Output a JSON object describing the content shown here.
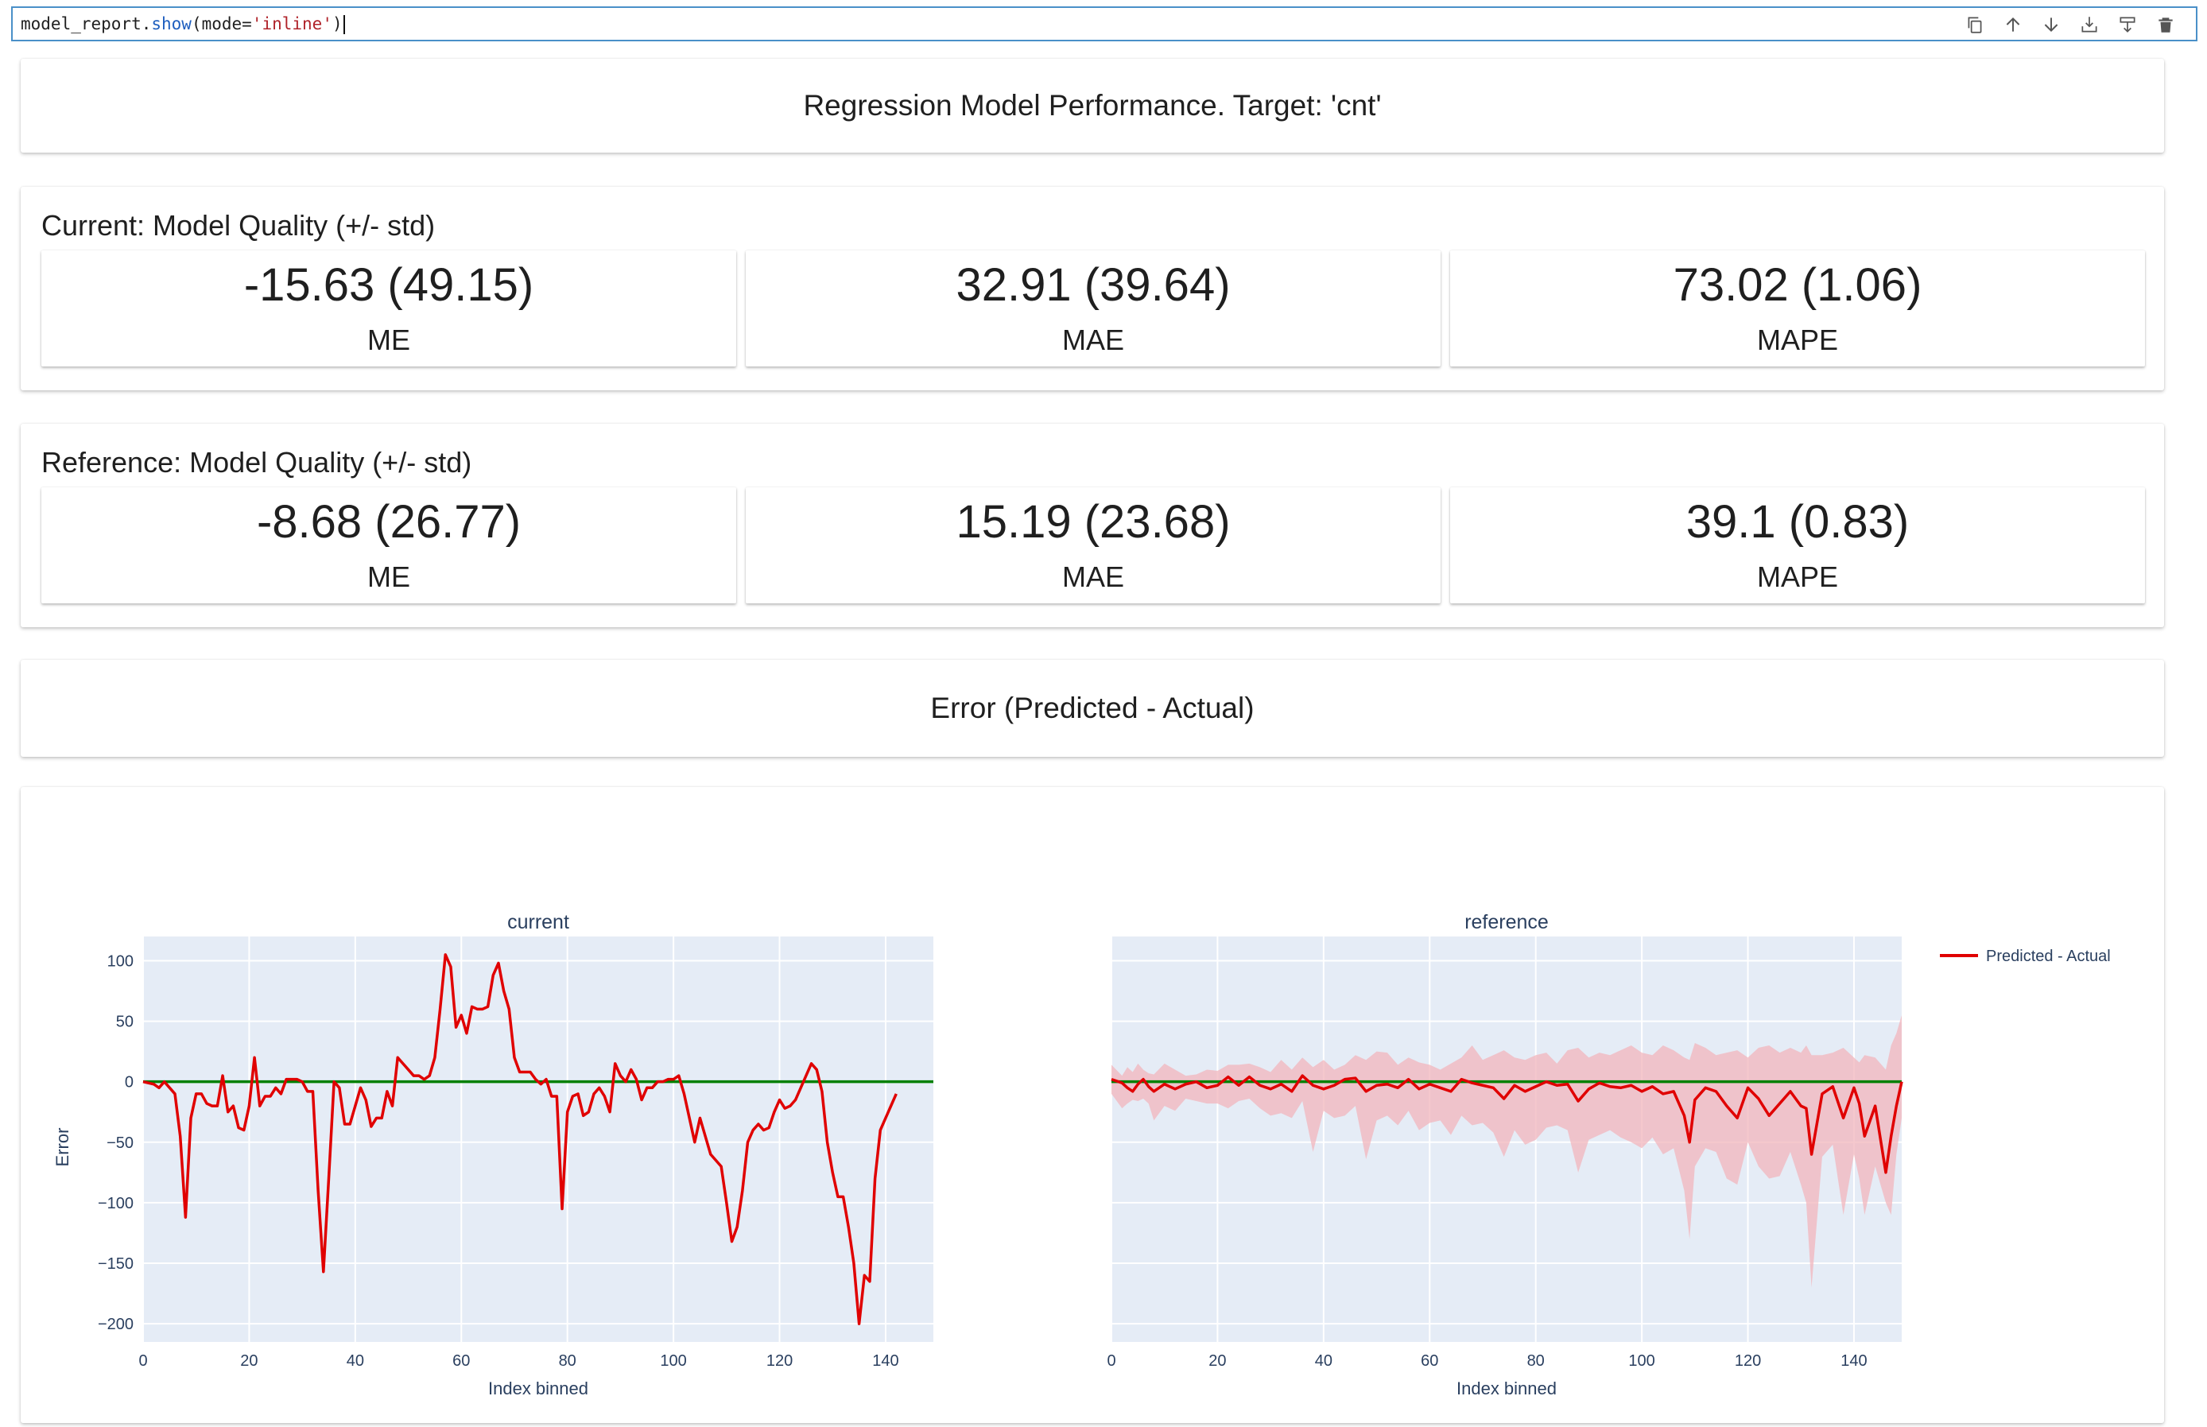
{
  "cell": {
    "code_prefix": "model_report.",
    "code_fn": "show",
    "code_open": "(mode=",
    "code_str": "'inline'",
    "code_close": ")"
  },
  "toolbar": {
    "icons": [
      "duplicate-icon",
      "move-up-icon",
      "move-down-icon",
      "insert-below-icon",
      "merge-icon",
      "delete-icon"
    ]
  },
  "report": {
    "title": "Regression Model Performance. Target: 'cnt'",
    "current": {
      "heading": "Current: Model Quality (+/- std)",
      "metrics": [
        {
          "value": "-15.63 (49.15)",
          "label": "ME"
        },
        {
          "value": "32.91 (39.64)",
          "label": "MAE"
        },
        {
          "value": "73.02 (1.06)",
          "label": "MAPE"
        }
      ]
    },
    "reference": {
      "heading": "Reference: Model Quality (+/- std)",
      "metrics": [
        {
          "value": "-8.68 (26.77)",
          "label": "ME"
        },
        {
          "value": "15.19 (23.68)",
          "label": "MAE"
        },
        {
          "value": "39.1 (0.83)",
          "label": "MAPE"
        }
      ]
    },
    "error_title": "Error (Predicted - Actual)"
  },
  "colors": {
    "plot_bg": "#e5ecf6",
    "line": "#e00000",
    "zero_line": "#008000",
    "band": "#f2b5bc",
    "cell_border": "#4a90c8"
  },
  "chart_data": {
    "type": "line",
    "ylabel": "Error",
    "xlabel": "Index binned",
    "xlim": [
      0,
      149
    ],
    "ylim": [
      -215,
      120
    ],
    "x_ticks": [
      0,
      20,
      40,
      60,
      80,
      100,
      120,
      140
    ],
    "y_ticks": [
      100,
      50,
      0,
      -50,
      -100,
      -150,
      -200
    ],
    "y_tick_labels": [
      "100",
      "50",
      "0",
      "−50",
      "−100",
      "−150",
      "−200"
    ],
    "legend": {
      "label": "Predicted - Actual",
      "position": "top-right"
    },
    "panels": [
      {
        "title": "current",
        "series": [
          {
            "name": "Predicted - Actual",
            "x": [
              0,
              2,
              3,
              4,
              6,
              7,
              8,
              9,
              10,
              11,
              12,
              13,
              14,
              15,
              16,
              17,
              18,
              19,
              20,
              21,
              22,
              23,
              24,
              25,
              26,
              27,
              28,
              29,
              30,
              31,
              32,
              33,
              34,
              35,
              36,
              37,
              38,
              39,
              40,
              41,
              42,
              43,
              44,
              45,
              46,
              47,
              48,
              49,
              50,
              51,
              52,
              53,
              54,
              55,
              56,
              57,
              58,
              59,
              60,
              61,
              62,
              63,
              64,
              65,
              66,
              67,
              68,
              69,
              70,
              71,
              72,
              73,
              74,
              75,
              76,
              77,
              78,
              79,
              80,
              81,
              82,
              83,
              84,
              85,
              86,
              87,
              88,
              89,
              90,
              91,
              92,
              93,
              94,
              95,
              96,
              97,
              98,
              99,
              100,
              101,
              102,
              103,
              104,
              105,
              106,
              107,
              108,
              109,
              110,
              111,
              112,
              113,
              114,
              115,
              116,
              117,
              118,
              119,
              120,
              121,
              122,
              123,
              124,
              125,
              126,
              127,
              128,
              129,
              130,
              131,
              132,
              133,
              134,
              135,
              136,
              137,
              138,
              139,
              140,
              141,
              142,
              143,
              144,
              145,
              146,
              147,
              148,
              149
            ],
            "y": [
              0,
              -2,
              -5,
              0,
              -10,
              -45,
              -112,
              -30,
              -10,
              -10,
              -18,
              -20,
              -20,
              5,
              -25,
              -20,
              -38,
              -40,
              -20,
              20,
              -20,
              -12,
              -12,
              -5,
              -10,
              2,
              2,
              2,
              0,
              -8,
              -8,
              -90,
              -157,
              -80,
              0,
              -5,
              -35,
              -35,
              -20,
              -5,
              -15,
              -37,
              -30,
              -30,
              -8,
              -20,
              20,
              15,
              10,
              5,
              5,
              2,
              5,
              20,
              60,
              105,
              95,
              45,
              55,
              40,
              62,
              60,
              60,
              62,
              88,
              98,
              75,
              60,
              20,
              8,
              8,
              8,
              2,
              -2,
              2,
              -12,
              -12,
              -105,
              -25,
              -12,
              -10,
              -28,
              -25,
              -10,
              -5,
              -12,
              -25,
              15,
              5,
              0,
              10,
              2,
              -15,
              -5,
              -5,
              0,
              0,
              2,
              2,
              5,
              -10,
              -30,
              -50,
              -30,
              -45,
              -60,
              -65,
              -70,
              -100,
              -132,
              -120,
              -90,
              -50,
              -40,
              -35,
              -40,
              -38,
              -25,
              -15,
              -22,
              -20,
              -15,
              -5,
              5,
              15,
              10,
              -8,
              -50,
              -75,
              -95,
              -95,
              -120,
              -150,
              -200,
              -160,
              -165,
              -80,
              -40,
              -30,
              -20,
              -10
            ],
            "color": "#e00000"
          }
        ],
        "zero_line": 0
      },
      {
        "title": "reference",
        "series": [
          {
            "name": "Predicted - Actual",
            "x": [
              0,
              2,
              3,
              4,
              5,
              6,
              7,
              8,
              10,
              12,
              14,
              16,
              18,
              20,
              22,
              24,
              26,
              28,
              30,
              32,
              34,
              36,
              38,
              40,
              42,
              44,
              46,
              48,
              50,
              52,
              54,
              56,
              58,
              60,
              62,
              64,
              66,
              68,
              70,
              72,
              74,
              76,
              78,
              80,
              82,
              84,
              86,
              88,
              90,
              92,
              94,
              96,
              98,
              100,
              102,
              104,
              106,
              108,
              109,
              110,
              112,
              114,
              116,
              118,
              120,
              122,
              124,
              126,
              128,
              130,
              131,
              132,
              134,
              136,
              138,
              140,
              141,
              142,
              144,
              146,
              147,
              148,
              149
            ],
            "y": [
              2,
              -1,
              -5,
              -8,
              -2,
              2,
              -4,
              -8,
              -2,
              -6,
              -2,
              0,
              -5,
              -3,
              4,
              -3,
              4,
              -3,
              -6,
              -2,
              -8,
              5,
              -3,
              -6,
              -3,
              2,
              3,
              -8,
              -3,
              -2,
              -5,
              2,
              -6,
              -2,
              -5,
              -8,
              2,
              -1,
              -3,
              -5,
              -14,
              -3,
              -8,
              -4,
              0,
              -3,
              -2,
              -16,
              -6,
              -1,
              -4,
              -5,
              -3,
              -8,
              -4,
              -10,
              -8,
              -28,
              -50,
              -15,
              -5,
              -8,
              -20,
              -30,
              -5,
              -14,
              -28,
              -18,
              -8,
              -20,
              -22,
              -60,
              -10,
              -4,
              -30,
              -5,
              -18,
              -45,
              -20,
              -75,
              -45,
              -20,
              0
            ],
            "band_upper": [
              14,
              5,
              12,
              8,
              15,
              10,
              7,
              6,
              15,
              10,
              5,
              6,
              10,
              9,
              14,
              14,
              15,
              12,
              8,
              18,
              10,
              20,
              12,
              18,
              10,
              14,
              22,
              18,
              25,
              24,
              14,
              20,
              16,
              14,
              10,
              15,
              20,
              30,
              18,
              22,
              26,
              20,
              18,
              22,
              24,
              15,
              26,
              28,
              20,
              24,
              22,
              26,
              30,
              24,
              22,
              30,
              26,
              20,
              18,
              32,
              28,
              22,
              24,
              26,
              20,
              28,
              30,
              24,
              28,
              24,
              30,
              22,
              22,
              24,
              28,
              20,
              16,
              22,
              20,
              10,
              30,
              40,
              55
            ],
            "band_lower": [
              -10,
              -22,
              -18,
              -15,
              -16,
              -14,
              -18,
              -32,
              -20,
              -24,
              -14,
              -16,
              -18,
              -18,
              -22,
              -16,
              -14,
              -22,
              -28,
              -26,
              -30,
              -16,
              -58,
              -24,
              -30,
              -28,
              -20,
              -64,
              -32,
              -28,
              -36,
              -24,
              -40,
              -34,
              -32,
              -44,
              -28,
              -36,
              -34,
              -42,
              -62,
              -40,
              -52,
              -48,
              -38,
              -36,
              -40,
              -75,
              -48,
              -44,
              -40,
              -46,
              -50,
              -55,
              -46,
              -60,
              -55,
              -90,
              -130,
              -70,
              -55,
              -58,
              -80,
              -85,
              -50,
              -70,
              -80,
              -78,
              -58,
              -85,
              -100,
              -170,
              -62,
              -52,
              -110,
              -60,
              -80,
              -110,
              -70,
              -100,
              -110,
              -60,
              -30
            ],
            "color": "#e00000"
          }
        ],
        "zero_line": 0
      }
    ]
  }
}
